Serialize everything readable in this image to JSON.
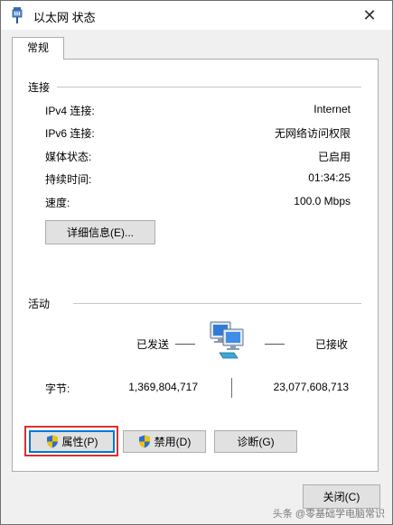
{
  "window": {
    "title": "以太网 状态",
    "close_glyph": "✕"
  },
  "tabs": [
    {
      "label": "常规"
    }
  ],
  "connection": {
    "section_label": "连接",
    "rows": [
      {
        "label": "IPv4 连接:",
        "value": "Internet"
      },
      {
        "label": "IPv6 连接:",
        "value": "无网络访问权限"
      },
      {
        "label": "媒体状态:",
        "value": "已启用"
      },
      {
        "label": "持续时间:",
        "value": "01:34:25"
      },
      {
        "label": "速度:",
        "value": "100.0 Mbps"
      }
    ],
    "details_button": "详细信息(E)..."
  },
  "activity": {
    "section_label": "活动",
    "sent_label": "已发送",
    "received_label": "已接收",
    "bytes_label": "字节:",
    "bytes_sent": "1,369,804,717",
    "bytes_received": "23,077,608,713"
  },
  "actions": {
    "properties": "属性(P)",
    "disable": "禁用(D)",
    "diagnose": "诊断(G)",
    "close": "关闭(C)"
  },
  "watermark": "头条 @零基础学电脑常识",
  "colors": {
    "highlight_border": "#d9302b",
    "focus_border": "#0078d7",
    "shield_blue": "#2a6fd0",
    "shield_yellow": "#f2c200"
  }
}
